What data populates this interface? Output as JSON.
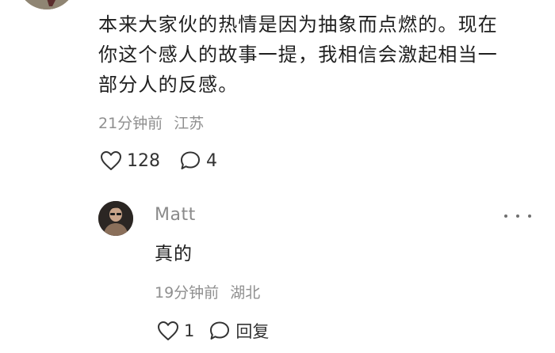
{
  "comment": {
    "text_lines": [
      "本来大家伙的热情是因为抽象而点燃的。现在",
      "你这个感人的故事一提，我相信会激起相当一",
      "部分人的反感。"
    ],
    "time": "21分钟前",
    "location": "江苏",
    "like_count": "128",
    "reply_count": "4"
  },
  "reply": {
    "author": "Matt",
    "text": "真的",
    "time": "19分钟前",
    "location": "湖北",
    "like_count": "1",
    "reply_label": "回复"
  },
  "icons": {
    "like": "heart-outline-icon",
    "comment": "speech-bubble-icon",
    "more": "more-dots-icon"
  },
  "colors": {
    "text_primary": "#1f1f1f",
    "text_secondary": "#8f8f8f",
    "icon": "#333333"
  }
}
